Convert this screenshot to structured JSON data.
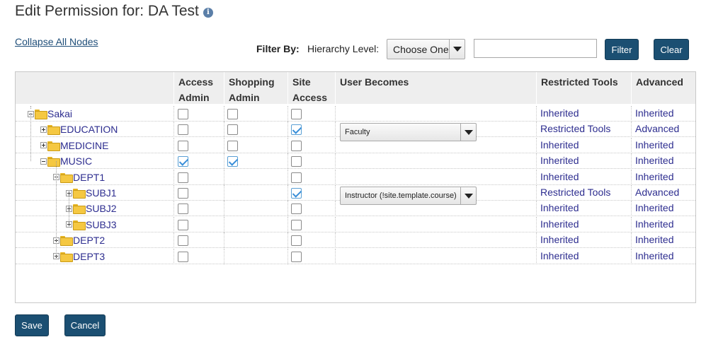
{
  "page": {
    "title": "Edit Permission for: DA Test"
  },
  "toolbar": {
    "collapse_label": "Collapse All Nodes",
    "filter_by_label": "Filter By:",
    "hierarchy_level_label": "Hierarchy Level:",
    "hierarchy_select_value": "Choose One",
    "filter_input_value": "",
    "filter_button": "Filter",
    "clear_button": "Clear"
  },
  "table": {
    "headers": {
      "access_admin": [
        "Access",
        "Admin"
      ],
      "shopping_admin": [
        "Shopping",
        "Admin"
      ],
      "site_access": [
        "Site",
        "Access"
      ],
      "user_becomes": "User Becomes",
      "restricted_tools": "Restricted Tools",
      "advanced": "Advanced"
    },
    "rows": [
      {
        "name": "Sakai",
        "access_admin": false,
        "shopping_admin": false,
        "site_access": false,
        "user_becomes": "",
        "restricted": "Inherited",
        "advanced": "Inherited"
      },
      {
        "name": "EDUCATION",
        "access_admin": false,
        "shopping_admin": false,
        "site_access": true,
        "user_becomes": "Faculty",
        "restricted": "Restricted Tools",
        "advanced": "Advanced"
      },
      {
        "name": "MEDICINE",
        "access_admin": false,
        "shopping_admin": false,
        "site_access": false,
        "user_becomes": "",
        "restricted": "Inherited",
        "advanced": "Inherited"
      },
      {
        "name": "MUSIC",
        "access_admin": true,
        "shopping_admin": true,
        "site_access": false,
        "user_becomes": "",
        "restricted": "Inherited",
        "advanced": "Inherited"
      },
      {
        "name": "DEPT1",
        "access_admin": false,
        "shopping_admin": null,
        "site_access": false,
        "user_becomes": "",
        "restricted": "Inherited",
        "advanced": "Inherited"
      },
      {
        "name": "SUBJ1",
        "access_admin": false,
        "shopping_admin": null,
        "site_access": true,
        "user_becomes": "Instructor (!site.template.course)",
        "restricted": "Restricted Tools",
        "advanced": "Advanced"
      },
      {
        "name": "SUBJ2",
        "access_admin": false,
        "shopping_admin": null,
        "site_access": false,
        "user_becomes": "",
        "restricted": "Inherited",
        "advanced": "Inherited"
      },
      {
        "name": "SUBJ3",
        "access_admin": false,
        "shopping_admin": null,
        "site_access": false,
        "user_becomes": "",
        "restricted": "Inherited",
        "advanced": "Inherited"
      },
      {
        "name": "DEPT2",
        "access_admin": false,
        "shopping_admin": null,
        "site_access": false,
        "user_becomes": "",
        "restricted": "Inherited",
        "advanced": "Inherited"
      },
      {
        "name": "DEPT3",
        "access_admin": false,
        "shopping_admin": null,
        "site_access": false,
        "user_becomes": "",
        "restricted": "Inherited",
        "advanced": "Inherited"
      }
    ]
  },
  "footer": {
    "save_button": "Save",
    "cancel_button": "Cancel"
  }
}
